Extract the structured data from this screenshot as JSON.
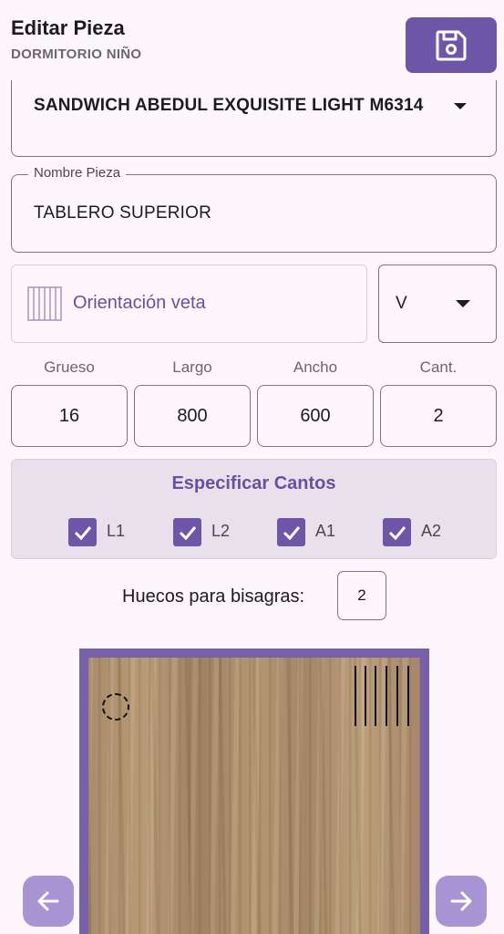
{
  "header": {
    "title": "Editar Pieza",
    "subtitle": "DORMITORIO NIÑO",
    "save_icon": "floppy-disk-icon"
  },
  "material": {
    "value": "SANDWICH ABEDUL EXQUISITE LIGHT M6314"
  },
  "piece_name": {
    "label": "Nombre Pieza",
    "value": "TABLERO SUPERIOR"
  },
  "grain": {
    "label": "Orientación veta",
    "selected": "V"
  },
  "dimensions": {
    "labels": [
      "Grueso",
      "Largo",
      "Ancho",
      "Cant."
    ],
    "values": [
      "16",
      "800",
      "600",
      "2"
    ]
  },
  "cantos": {
    "title": "Especificar Cantos",
    "items": [
      {
        "label": "L1",
        "checked": true
      },
      {
        "label": "L2",
        "checked": true
      },
      {
        "label": "A1",
        "checked": true
      },
      {
        "label": "A2",
        "checked": true
      }
    ]
  },
  "hinges": {
    "label": "Huecos para bisagras:",
    "value": "2"
  },
  "colors": {
    "accent": "#6F55A7",
    "accent_text": "#6650A4",
    "nav_button": "#A893D3",
    "background": "#FDF7FD"
  },
  "nav": {
    "prev_icon": "arrow-left-icon",
    "next_icon": "arrow-right-icon"
  }
}
